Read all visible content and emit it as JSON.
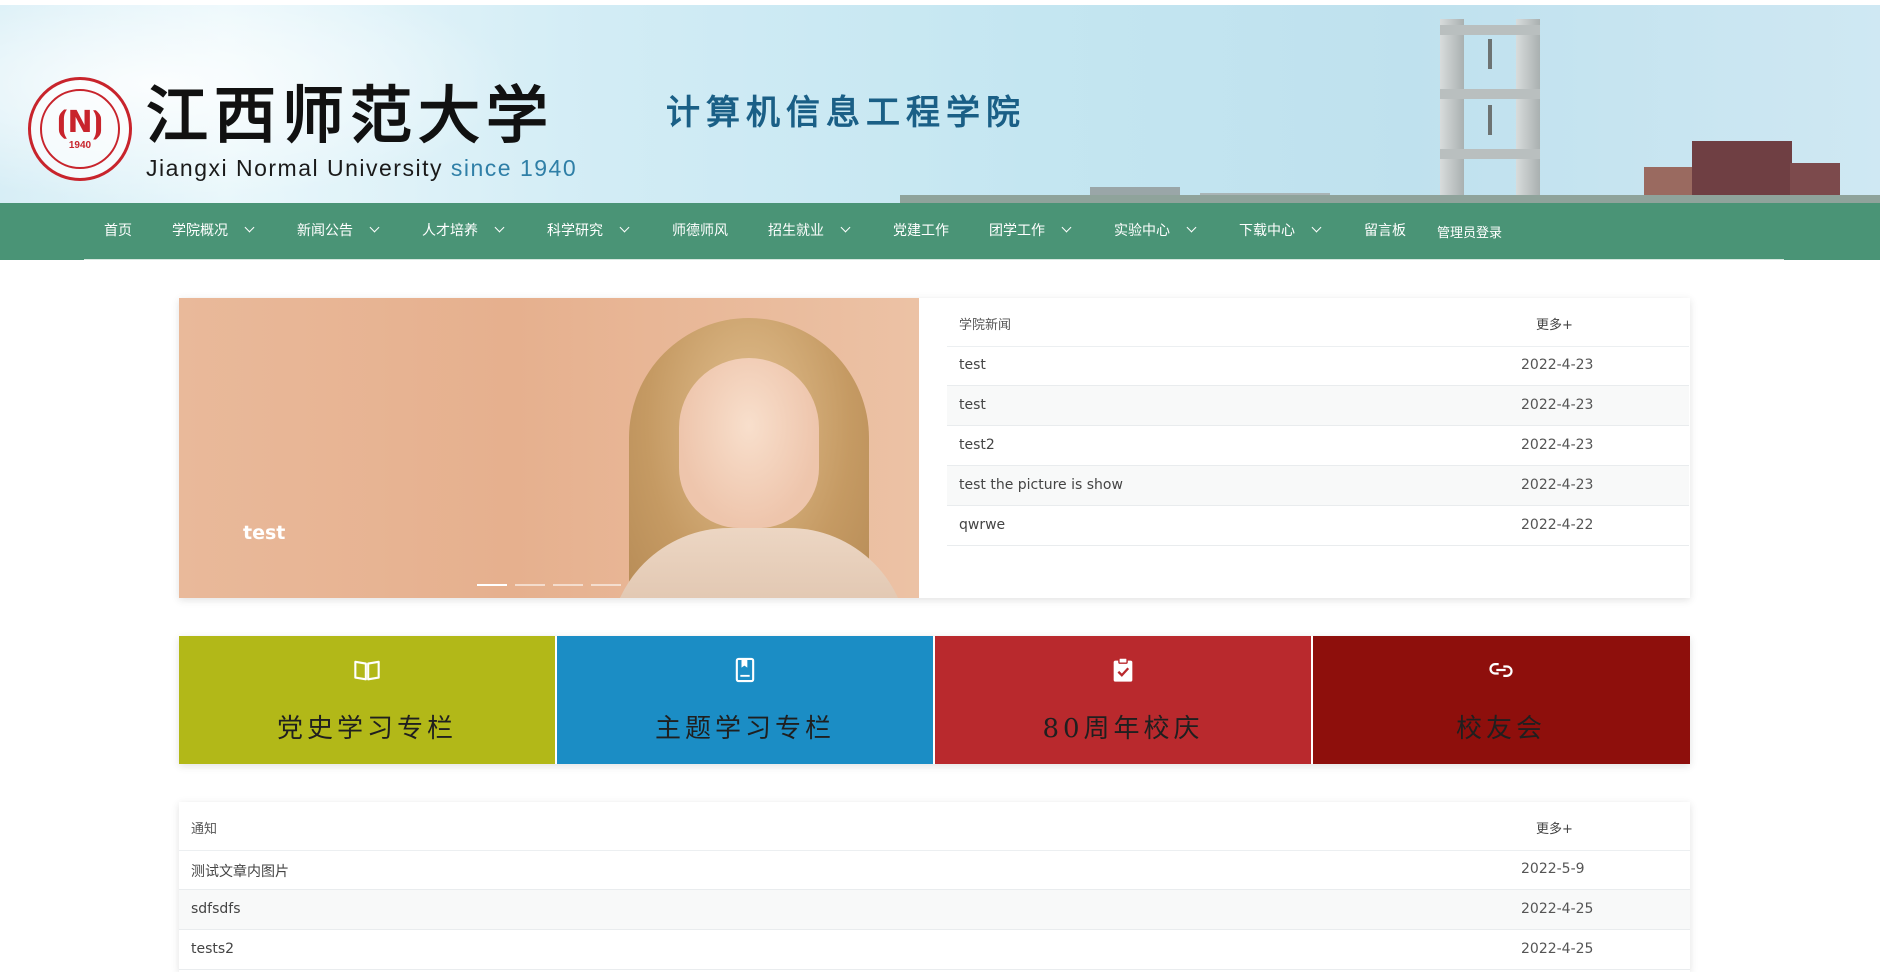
{
  "header": {
    "university_cn": "江西师范大学",
    "university_en": "Jiangxi Normal University",
    "since": "since 1940",
    "college_cn": "计算机信息工程学院",
    "seal_year": "1940"
  },
  "nav": {
    "items": [
      {
        "label": "首页",
        "dropdown": false
      },
      {
        "label": "学院概况",
        "dropdown": true
      },
      {
        "label": "新闻公告",
        "dropdown": true
      },
      {
        "label": "人才培养",
        "dropdown": true
      },
      {
        "label": "科学研究",
        "dropdown": true
      },
      {
        "label": "师德师风",
        "dropdown": false
      },
      {
        "label": "招生就业",
        "dropdown": true
      },
      {
        "label": "党建工作",
        "dropdown": false
      },
      {
        "label": "团学工作",
        "dropdown": true
      },
      {
        "label": "实验中心",
        "dropdown": true
      },
      {
        "label": "下载中心",
        "dropdown": true
      },
      {
        "label": "留言板",
        "dropdown": false
      },
      {
        "label": "管理员登录",
        "dropdown": false
      }
    ]
  },
  "carousel": {
    "caption": "test",
    "slide_count": 4,
    "active_index": 0
  },
  "news": {
    "title": "学院新闻",
    "more": "更多+",
    "rows": [
      {
        "title": "test",
        "date": "2022-4-23"
      },
      {
        "title": "test",
        "date": "2022-4-23"
      },
      {
        "title": "test2",
        "date": "2022-4-23"
      },
      {
        "title": "test the picture is show",
        "date": "2022-4-23"
      },
      {
        "title": "qwrwe",
        "date": "2022-4-22"
      }
    ]
  },
  "tiles": [
    {
      "label": "党史学习专栏",
      "icon": "open-book-icon",
      "color": "#b2b818"
    },
    {
      "label": "主题学习专栏",
      "icon": "bookmark-book-icon",
      "color": "#1b8dc5"
    },
    {
      "label": "80周年校庆",
      "icon": "clipboard-check-icon",
      "color": "#b9292d"
    },
    {
      "label": "校友会",
      "icon": "link-chain-icon",
      "color": "#8e0f0c"
    }
  ],
  "notice": {
    "title": "通知",
    "more": "更多+",
    "rows": [
      {
        "title": "测试文章内图片",
        "date": "2022-5-9"
      },
      {
        "title": "sdfsdfs",
        "date": "2022-4-25"
      },
      {
        "title": "tests2",
        "date": "2022-4-25"
      }
    ]
  },
  "colors": {
    "nav_bg": "#4a9476",
    "accent_blue": "#1a5f86"
  }
}
